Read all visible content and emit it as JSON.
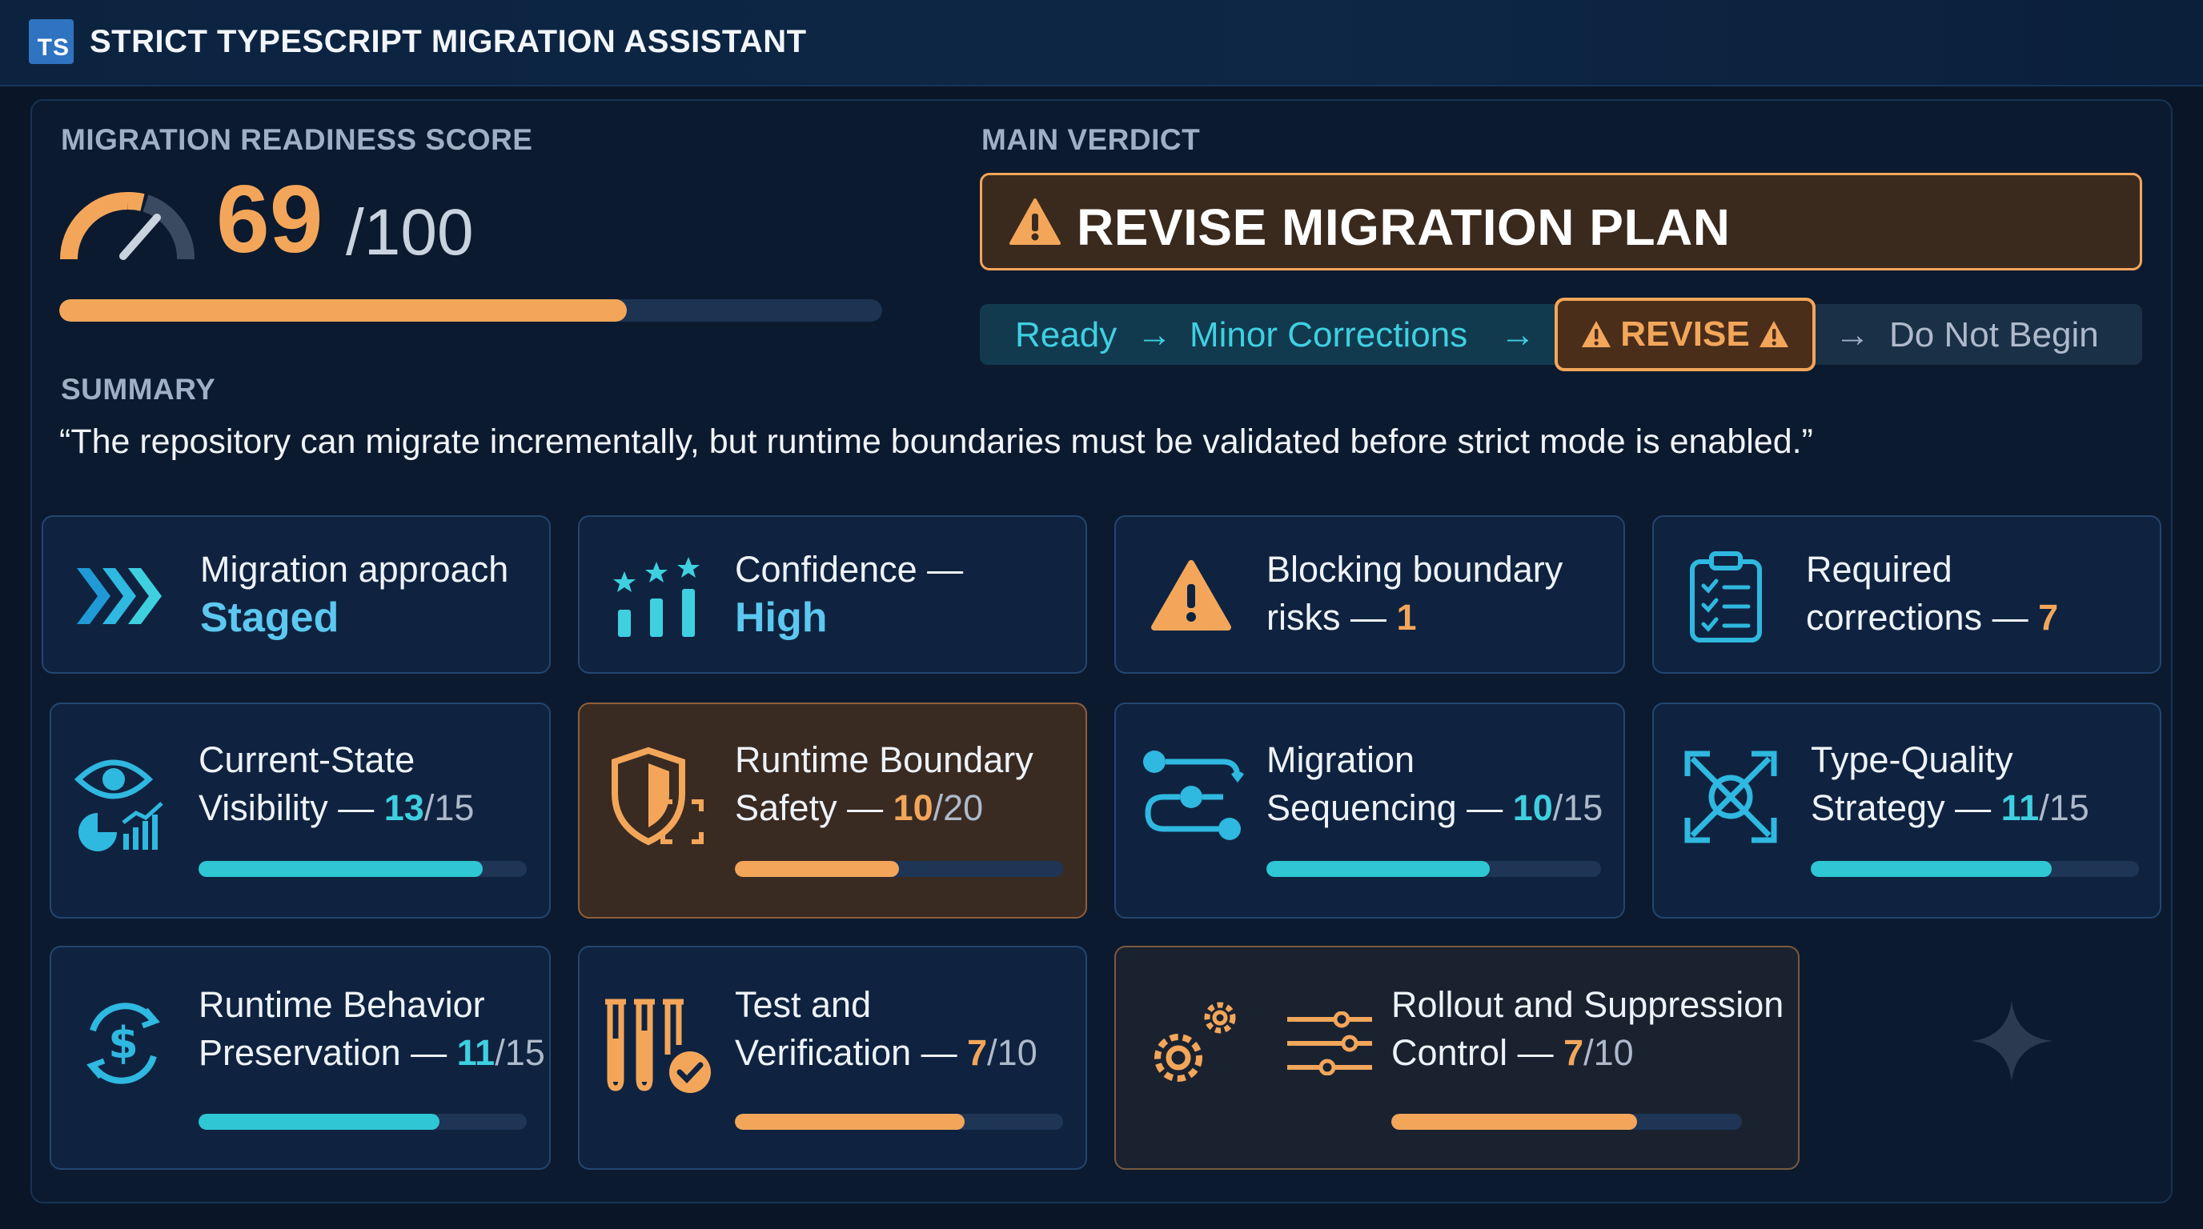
{
  "app": {
    "logo_text": "TS",
    "title": "STRICT TYPESCRIPT MIGRATION ASSISTANT"
  },
  "readiness": {
    "label": "MIGRATION READINESS SCORE",
    "score": "69",
    "max": "/100",
    "progress_fraction": 0.69
  },
  "verdict": {
    "label": "MAIN VERDICT",
    "text": "REVISE MIGRATION PLAN",
    "scale": {
      "ready": "Ready",
      "minor": "Minor Corrections",
      "revise": "REVISE",
      "do_not_begin": "Do Not Begin",
      "arrow": "→"
    }
  },
  "summary": {
    "label": "SUMMARY",
    "text": "“The repository can migrate incrementally, but runtime boundaries must be validated before strict mode is enabled.”"
  },
  "stats": {
    "approach": {
      "label": "Migration approach",
      "value": "Staged"
    },
    "confidence": {
      "label": "Confidence —",
      "value": "High"
    },
    "blocking": {
      "line1": "Blocking boundary",
      "line2": "risks —",
      "value": "1"
    },
    "corrections": {
      "line1": "Required",
      "line2": "corrections —",
      "value": "7"
    }
  },
  "criteria": [
    {
      "line1": "Current-State",
      "line2": "Visibility —",
      "score": "13",
      "max": "/15",
      "fraction": 0.867,
      "status": "ok",
      "icon": "eye-chart-icon"
    },
    {
      "line1": "Runtime Boundary",
      "line2": "Safety —",
      "score": "10",
      "max": "/20",
      "fraction": 0.5,
      "status": "warn",
      "icon": "shield-boundary-icon"
    },
    {
      "line1": "Migration",
      "line2": "Sequencing —",
      "score": "10",
      "max": "/15",
      "fraction": 0.667,
      "status": "ok",
      "icon": "flow-sequence-icon"
    },
    {
      "line1": "Type-Quality",
      "line2": "Strategy —",
      "score": "11",
      "max": "/15",
      "fraction": 0.733,
      "status": "ok",
      "icon": "expand-target-icon"
    },
    {
      "line1": "Runtime Behavior",
      "line2": "Preservation —",
      "score": "11",
      "max": "/15",
      "fraction": 0.733,
      "status": "ok",
      "icon": "dollar-cycle-icon"
    },
    {
      "line1": "Test and",
      "line2": "Verification —",
      "score": "7",
      "max": "/10",
      "fraction": 0.7,
      "status": "warn",
      "icon": "test-tubes-icon"
    },
    {
      "line1": "Rollout and Suppression",
      "line2": "Control —",
      "score": "7",
      "max": "/10",
      "fraction": 0.7,
      "status": "warn",
      "icon": "gears-sliders-icon"
    }
  ],
  "colors": {
    "accent_orange": "#f3a65a",
    "accent_teal": "#3fd0e0",
    "background": "#0a1628"
  }
}
